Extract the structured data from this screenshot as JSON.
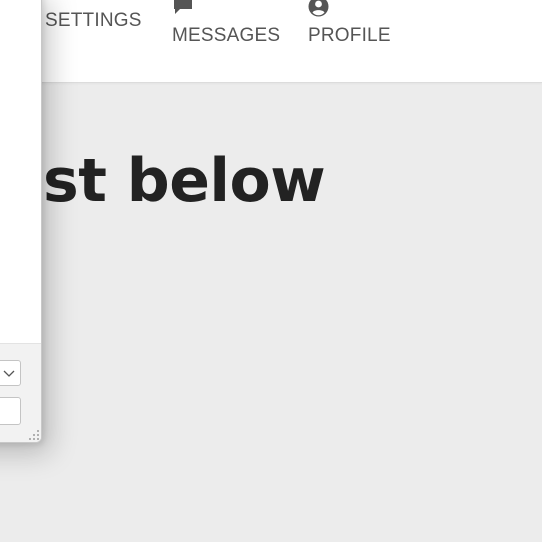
{
  "nav": {
    "settings_label": "SETTINGS",
    "messages_label": "MESSAGES",
    "profile_label": "PROFILE",
    "messages_icon": "chat-bubble-icon",
    "profile_icon": "user-circle-icon"
  },
  "main": {
    "heading": "st below"
  },
  "overlay": {
    "select_icon": "chevron-down-icon",
    "grip_icon": "resize-grip-icon"
  },
  "colors": {
    "background": "#ececec",
    "nav_background": "#ffffff",
    "nav_text": "#555555",
    "heading_text": "#222222",
    "icon": "#555555"
  }
}
